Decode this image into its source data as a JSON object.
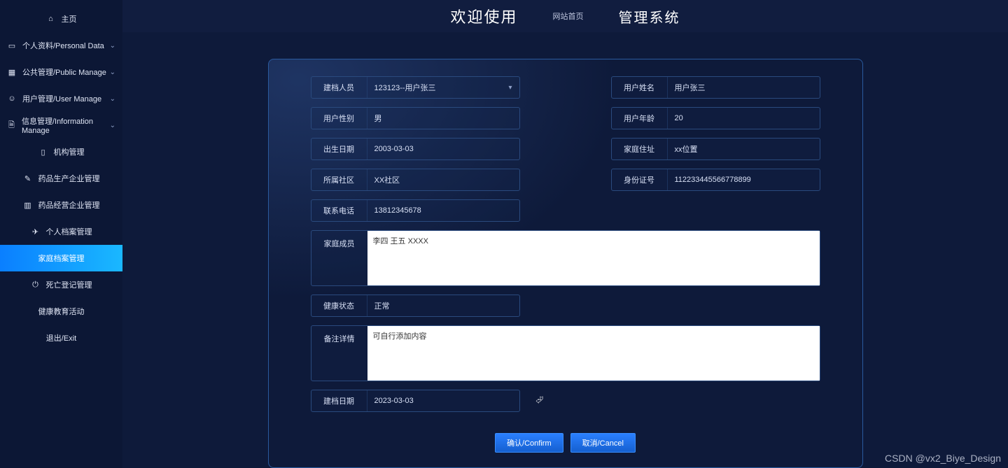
{
  "sidebar": {
    "home": "主页",
    "items": [
      {
        "icon": "id-icon",
        "label": "个人资料/Personal Data",
        "chev": true
      },
      {
        "icon": "grid-icon",
        "label": "公共管理/Public Manage",
        "chev": true
      },
      {
        "icon": "users-icon",
        "label": "用户管理/User Manage",
        "chev": true
      },
      {
        "icon": "doc-icon",
        "label": "信息管理/Information Manage",
        "chev": true
      }
    ],
    "sub": [
      {
        "icon": "building-icon",
        "label": "机构管理"
      },
      {
        "icon": "pill-icon",
        "label": "药品生产企业管理"
      },
      {
        "icon": "shop-icon",
        "label": "药品经营企业管理"
      },
      {
        "icon": "file-icon",
        "label": "个人档案管理"
      },
      {
        "icon": "folder-icon",
        "label": "家庭档案管理",
        "active": true
      },
      {
        "icon": "power-icon",
        "label": "死亡登记管理"
      },
      {
        "icon": "",
        "label": "健康教育活动"
      },
      {
        "icon": "",
        "label": "退出/Exit"
      }
    ]
  },
  "topbar": {
    "welcome": "欢迎使用",
    "link": "网站首页",
    "sysname": "管理系统"
  },
  "form": {
    "creator": {
      "label": "建档人员",
      "value": "123123--用户张三"
    },
    "username": {
      "label": "用户姓名",
      "value": "用户张三"
    },
    "gender": {
      "label": "用户性别",
      "value": "男"
    },
    "age": {
      "label": "用户年龄",
      "value": "20"
    },
    "birthday": {
      "label": "出生日期",
      "value": "2003-03-03"
    },
    "address": {
      "label": "家庭住址",
      "value": "xx位置"
    },
    "community": {
      "label": "所属社区",
      "value": "XX社区"
    },
    "idcard": {
      "label": "身份证号",
      "value": "112233445566778899"
    },
    "phone": {
      "label": "联系电话",
      "value": "13812345678"
    },
    "members": {
      "label": "家庭成员",
      "value": "李四 王五 XXXX"
    },
    "health": {
      "label": "健康状态",
      "value": "正常"
    },
    "remark": {
      "label": "备注详情",
      "value": "可自行添加内容"
    },
    "createdate": {
      "label": "建档日期",
      "value": "2023-03-03"
    }
  },
  "buttons": {
    "confirm": "确认/Confirm",
    "cancel": "取消/Cancel"
  },
  "watermark": "CSDN @vx2_Biye_Design"
}
